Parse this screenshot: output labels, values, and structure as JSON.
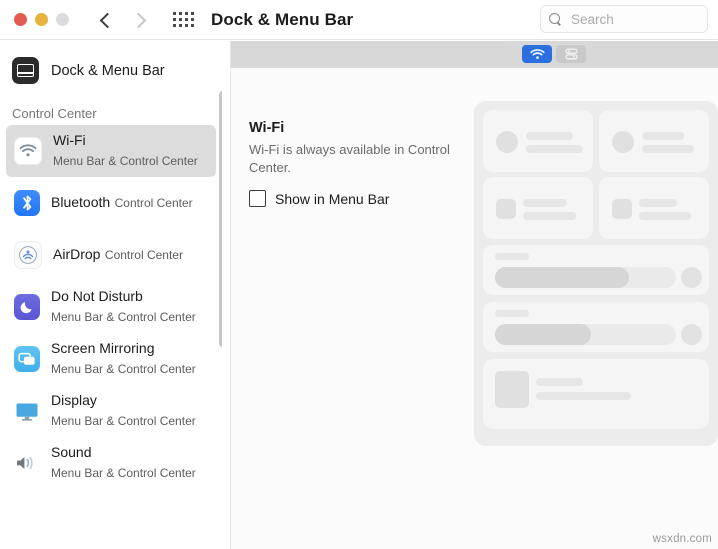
{
  "window": {
    "title": "Dock & Menu Bar",
    "traffic_lights": [
      "close",
      "minimize",
      "zoom"
    ],
    "nav": {
      "back": "back-chevron",
      "forward": "forward-chevron"
    },
    "show_all_icon": "grid-icon"
  },
  "search": {
    "placeholder": "Search",
    "value": "",
    "icon": "search-icon"
  },
  "sidebar": {
    "header": {
      "label": "Dock & Menu Bar",
      "icon": "dock-menu-bar-icon"
    },
    "group_label": "Control Center",
    "items": [
      {
        "label": "Wi-Fi",
        "sublabel": "Menu Bar & Control Center",
        "icon": "wifi-icon",
        "selected": true
      },
      {
        "label": "Bluetooth",
        "sublabel": "Control Center",
        "icon": "bluetooth-icon",
        "selected": false
      },
      {
        "label": "AirDrop",
        "sublabel": "Control Center",
        "icon": "airdrop-icon",
        "selected": false
      },
      {
        "label": "Do Not Disturb",
        "sublabel": "Menu Bar & Control Center",
        "icon": "moon-icon",
        "selected": false
      },
      {
        "label": "Screen Mirroring",
        "sublabel": "Menu Bar & Control Center",
        "icon": "screen-mirroring-icon",
        "selected": false
      },
      {
        "label": "Display",
        "sublabel": "Menu Bar & Control Center",
        "icon": "display-icon",
        "selected": false
      },
      {
        "label": "Sound",
        "sublabel": "Menu Bar & Control Center",
        "icon": "sound-icon",
        "selected": false
      }
    ]
  },
  "main": {
    "title": "Wi-Fi",
    "description": "Wi-Fi is always available in Control Center.",
    "checkbox": {
      "label": "Show in Menu Bar",
      "checked": false
    },
    "menu_bar_preview": {
      "items": [
        {
          "icon": "wifi-icon",
          "state": "active"
        },
        {
          "icon": "control-center-icon",
          "state": "idle"
        }
      ]
    }
  },
  "colors": {
    "accent": "#2b6fe0",
    "selection": "#dcdcdc",
    "panel_bg": "#fbfbfb",
    "preview_bg": "#ececec"
  },
  "watermark": "wsxdn.com"
}
